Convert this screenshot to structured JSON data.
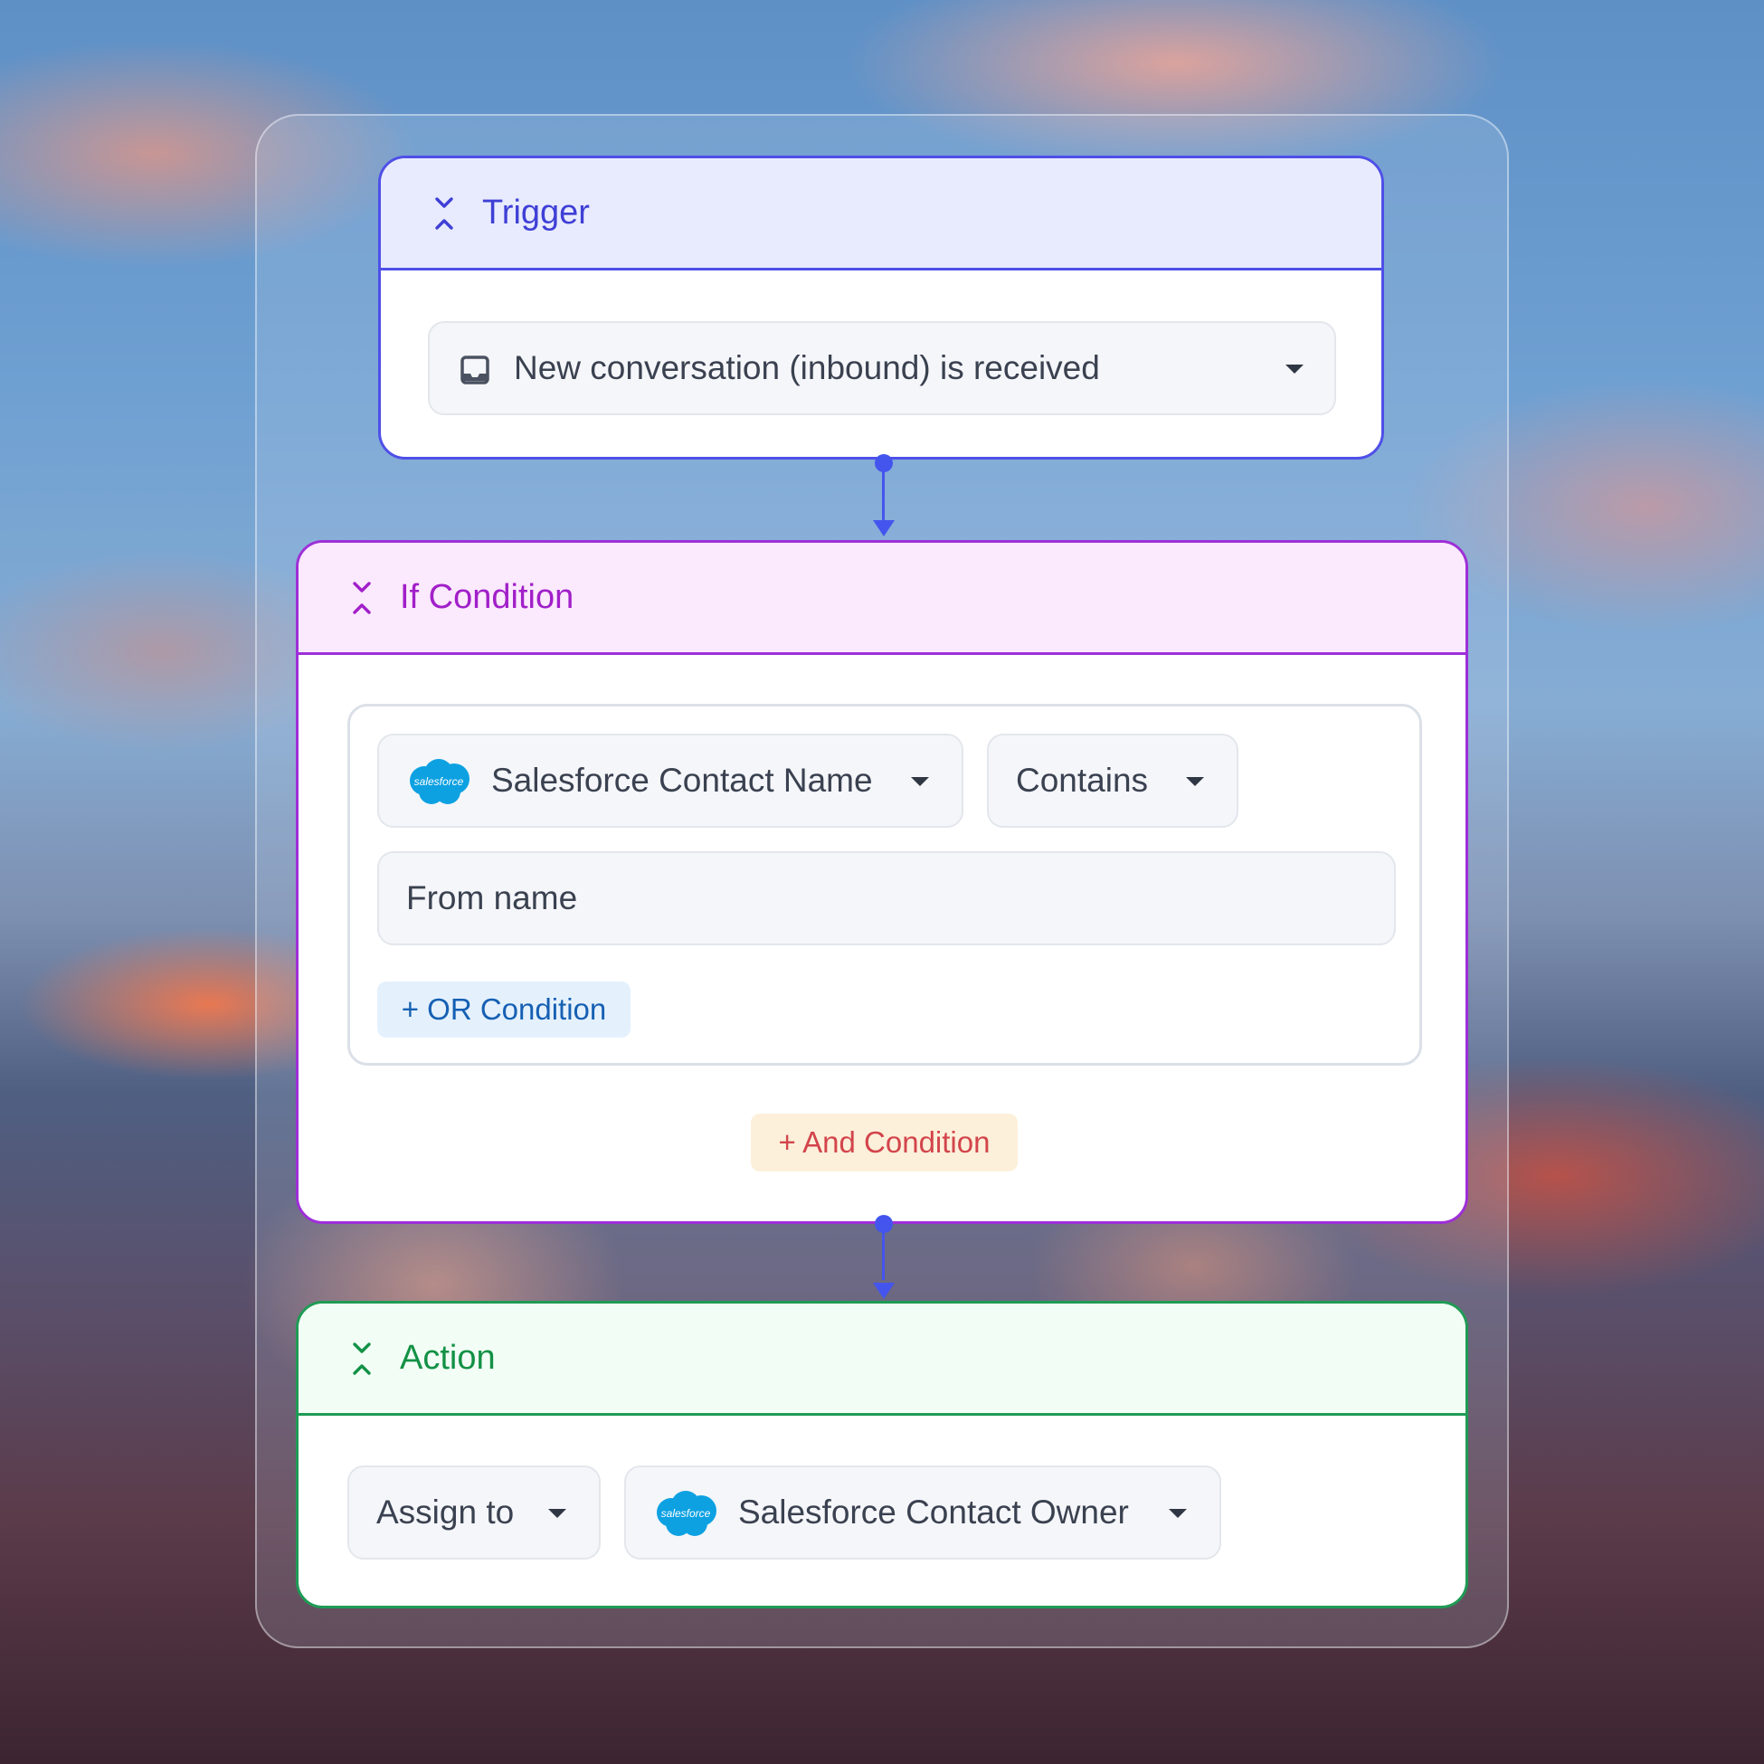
{
  "trigger": {
    "title": "Trigger",
    "event_value": "New conversation (inbound) is received"
  },
  "if_condition": {
    "title": "If Condition",
    "field_value": "Salesforce Contact Name",
    "operator_value": "Contains",
    "compare_value": "From name",
    "or_button_label": "+ OR Condition",
    "and_button_label": "+ And Condition"
  },
  "action": {
    "title": "Action",
    "action_value": "Assign to",
    "target_value": "Salesforce Contact Owner"
  },
  "salesforce_logo_text": "salesforce",
  "icons": {
    "collapse": "collapse-icon",
    "inbox": "inbox-icon",
    "caret": "caret-down-icon",
    "salesforce": "salesforce-logo"
  },
  "colors": {
    "trigger_accent": "#4f4fe8",
    "condition_accent": "#9e2fd8",
    "action_accent": "#1f9b55",
    "connector": "#4455ee"
  }
}
